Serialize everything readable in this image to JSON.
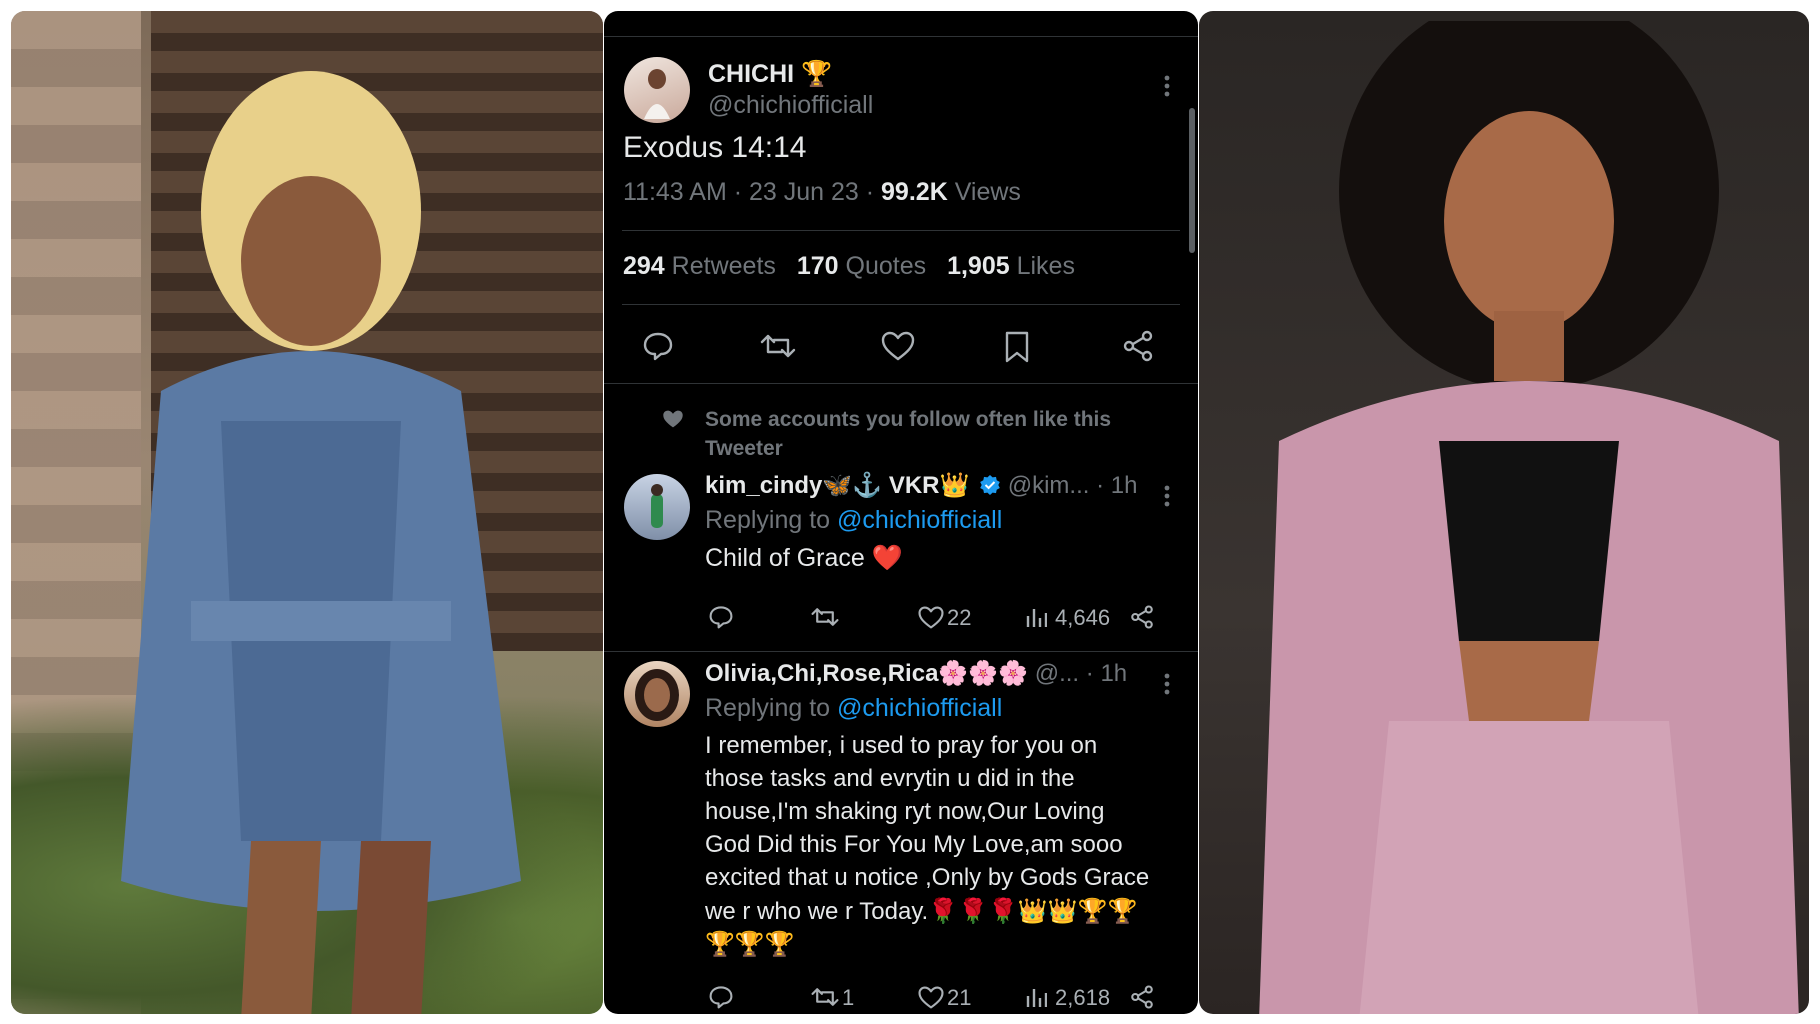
{
  "post": {
    "display_name": "CHICHI",
    "name_badge": "🏆",
    "handle": "@chichiofficiall",
    "text": "Exodus 14:14",
    "time": "11:43 AM · 23 Jun 23 · ",
    "views_count": "99.2K",
    "views_label": " Views",
    "retweets_count": "294",
    "retweets_label": "Retweets",
    "quotes_count": "170",
    "quotes_label": "Quotes",
    "likes_count": "1,905",
    "likes_label": "Likes"
  },
  "suggestion": {
    "line1": "Some accounts you follow often like this",
    "line2": "Tweeter"
  },
  "replies": [
    {
      "display_name": "kim_cindy🦋⚓ VKR👑",
      "handle": "@kim...",
      "time": "· 1h",
      "replying_prefix": "Replying to ",
      "replying_handle": "@chichiofficiall",
      "text_lines": [
        "Child of Grace ❤️"
      ],
      "retweets": "",
      "likes": "22",
      "views": "4,646"
    },
    {
      "display_name": "Olivia,Chi,Rose,Rica🌸🌸🌸",
      "handle": "@...",
      "time": "· 1h",
      "replying_prefix": "Replying to ",
      "replying_handle": "@chichiofficiall",
      "text_lines": [
        "I remember, i used to pray for you on",
        "those tasks and evrytin u did in the",
        "house,I'm shaking ryt now,Our Loving",
        "God Did this For You My Love,am sooo",
        "excited that u notice ,Only by Gods Grace",
        "we r who we r Today.🌹🌹🌹👑👑🏆🏆",
        "🏆🏆🏆"
      ],
      "retweets": "1",
      "likes": "21",
      "views": "2,618"
    }
  ],
  "colors": {
    "background": "#000000",
    "text": "#e7e9ea",
    "muted": "#71767b",
    "link": "#1d9bf0",
    "verified": "#1d9bf0"
  },
  "icons": [
    "reply-icon",
    "retweet-icon",
    "like-icon",
    "bookmark-icon",
    "share-icon",
    "views-icon",
    "more-icon",
    "verified-icon"
  ]
}
